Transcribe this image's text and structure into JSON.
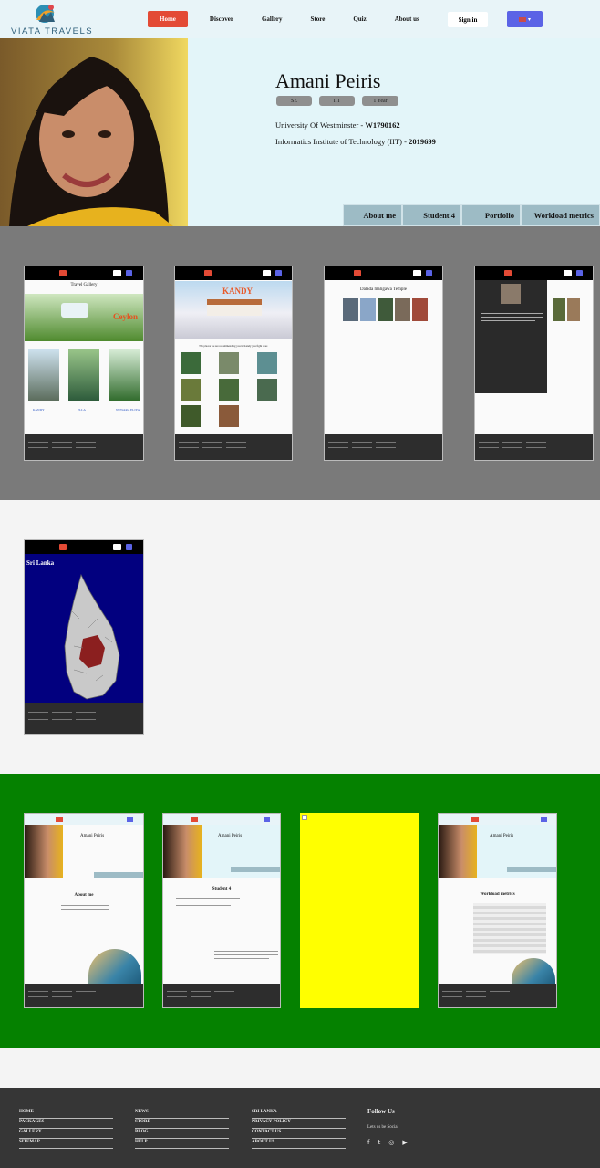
{
  "brand": {
    "name": "VIATA TRAVELS"
  },
  "nav": {
    "items": [
      "Home",
      "Discover",
      "Gallery",
      "Store",
      "Quiz",
      "About us"
    ],
    "signin": "Sign in",
    "lang_icon": "flag-icon",
    "lang_caret": "▾"
  },
  "profile": {
    "name": "Amani Peiris",
    "tags": [
      "SE",
      "IIT",
      "1 Year"
    ],
    "university_text": "University Of Westminster - ",
    "university_id": "W1790162",
    "institute_text": "Informatics Institute of Technology (IIT) - ",
    "institute_id": "2019699"
  },
  "tabs": [
    "About me",
    "Student 4",
    "Portfolio",
    "Workload metrics"
  ],
  "thumbnails": {
    "gallery_title": "Travel Gallery",
    "gallery_overlay": "Ceylon",
    "gallery_captions": [
      "KANDY",
      "ELLA",
      "NUWARA ELIYA"
    ],
    "kandy_banner": "KANDY",
    "kandy_subtitle": "The places we are recommending you in Kandy you fight over.",
    "temple_title": "Dalada maligawa Temple",
    "map_title": "Sri Lanka",
    "about_title": "About me",
    "student_title": "Student 4",
    "metrics_title": "Workload metrics",
    "mini_name": "Amani Peiris"
  },
  "footer": {
    "col1": [
      "HOME",
      "PACKAGES",
      "GALLERY",
      "SITEMAP"
    ],
    "col2": [
      "NEWS",
      "STORE",
      "BLOG",
      "HELP"
    ],
    "col3": [
      "SRI LANKA",
      "PRIVACY POLICY",
      "CONTACT US",
      "ABOUT US"
    ],
    "follow_title": "Follow Us",
    "follow_text": "Lets us be Social",
    "social": [
      "f",
      "t",
      "◎",
      "▶"
    ],
    "social_icons": [
      "facebook-icon",
      "twitter-icon",
      "instagram-icon",
      "youtube-icon"
    ]
  },
  "colors": {
    "accent": "#e34a35",
    "lang": "#5b63e6",
    "hero_bg": "#e3f5f9",
    "tab_bg": "#9dbbc5",
    "section_gray": "#7a7a7a",
    "section_green": "#058100",
    "footer": "#363636"
  }
}
